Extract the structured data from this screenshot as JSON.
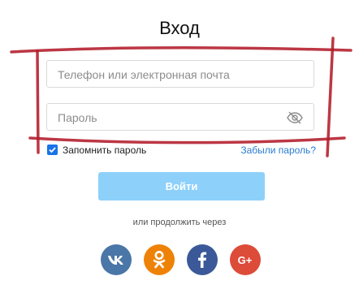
{
  "title": "Вход",
  "phone_input": {
    "placeholder": "Телефон или электронная почта",
    "value": ""
  },
  "password_input": {
    "placeholder": "Пароль",
    "value": "",
    "toggle_icon": "eye-slash-icon"
  },
  "remember_me": {
    "label": "Запомнить пароль",
    "checked": true
  },
  "forgot_link": "Забыли пароль?",
  "login_button": "Войти",
  "social_caption": "или продолжить через",
  "social": [
    {
      "icon": "vk-icon",
      "color": "#4a76a8"
    },
    {
      "icon": "odnoklassniki-icon",
      "color": "#ee8208"
    },
    {
      "icon": "facebook-icon",
      "color": "#3b5998"
    },
    {
      "icon": "google-plus-icon",
      "color": "#dd4b39"
    }
  ],
  "colors": {
    "accent": "#1a73e8",
    "button_disabled": "#8dd1fb",
    "link": "#2a7ccf",
    "annotation": "#b31b2a"
  }
}
